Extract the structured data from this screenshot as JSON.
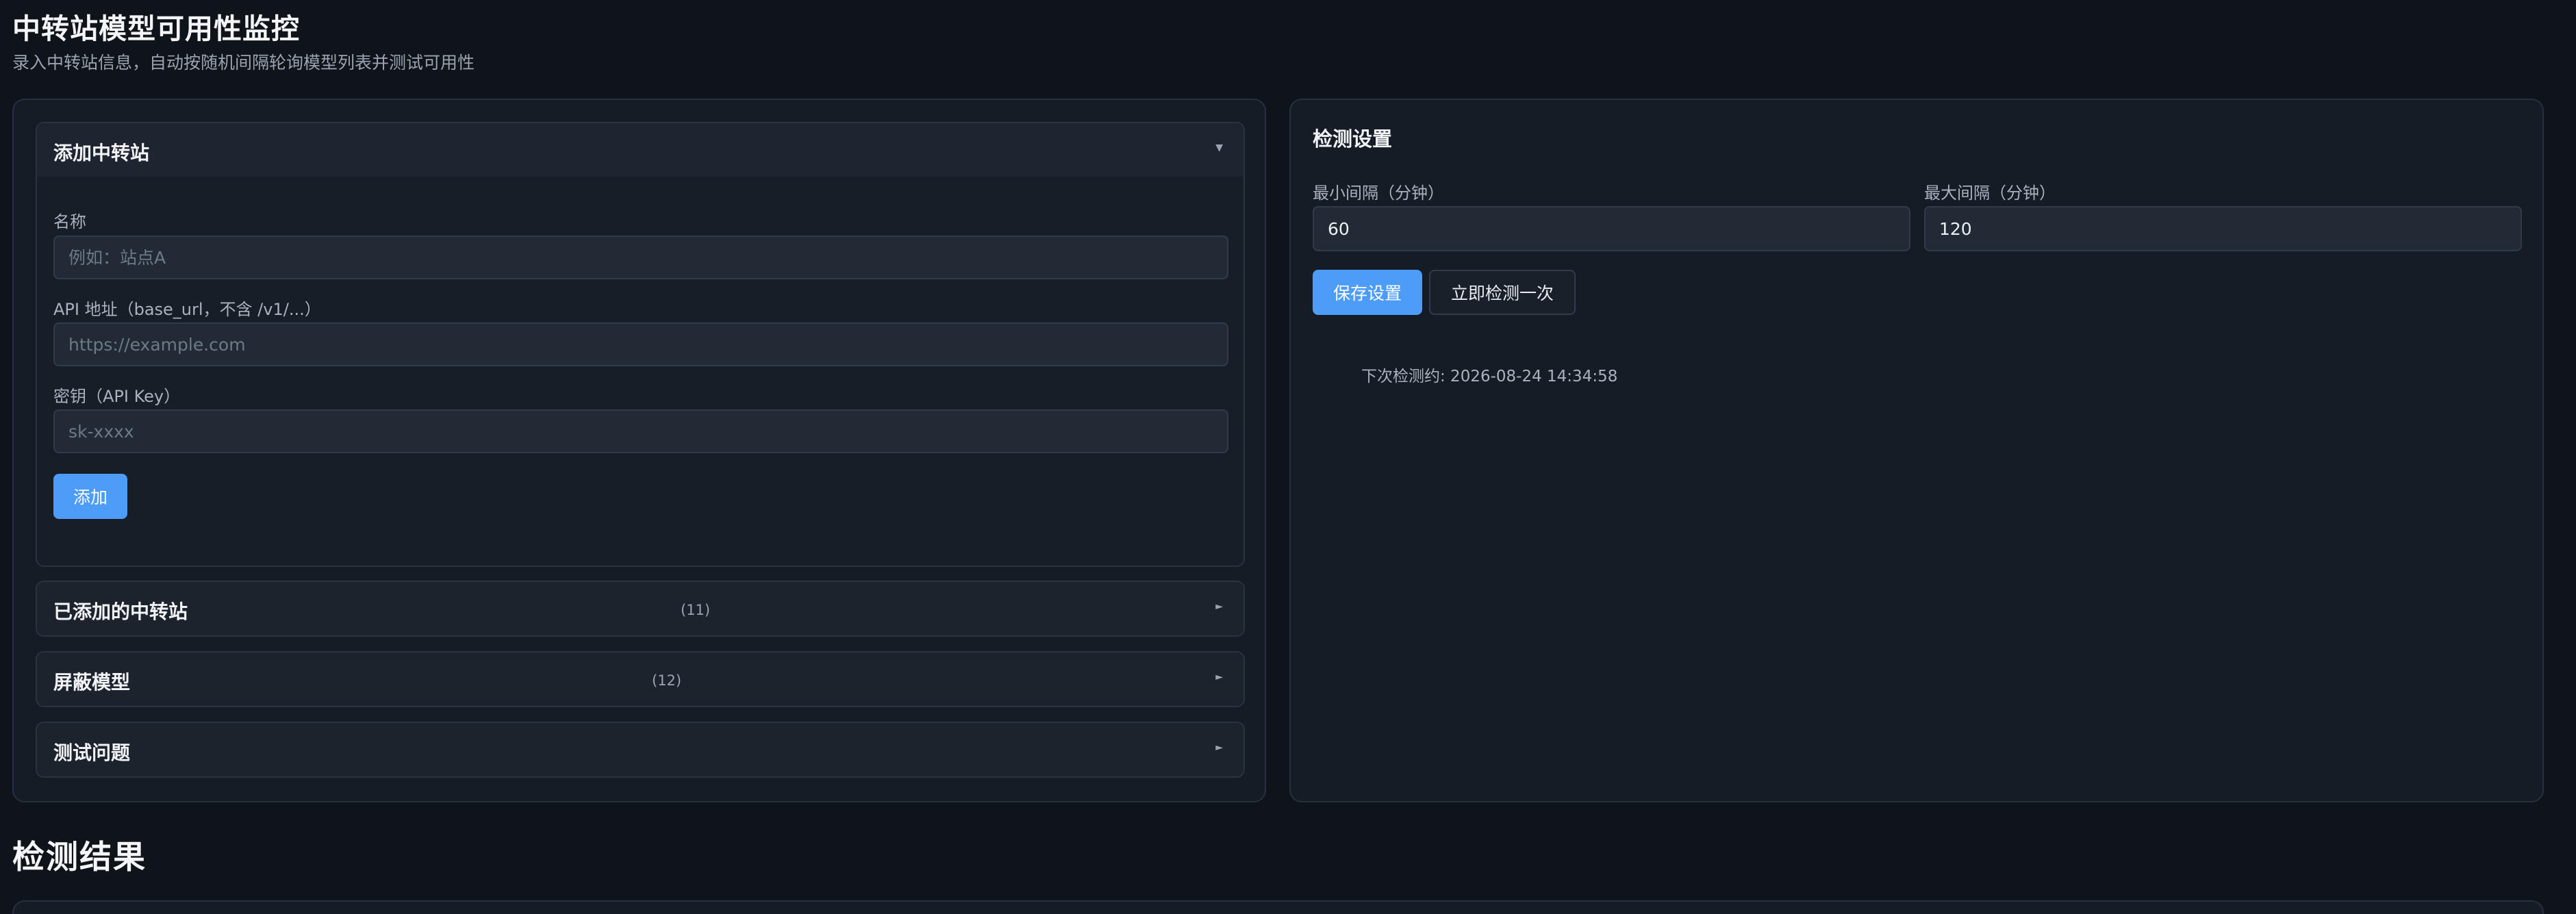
{
  "header": {
    "title": "中转站模型可用性监控",
    "subtitle": "录入中转站信息，自动按随机间隔轮询模型列表并测试可用性"
  },
  "add_station": {
    "title": "添加中转站",
    "name_label": "名称",
    "name_placeholder": "例如：站点A",
    "api_label": "API 地址（base_url，不含 /v1/...）",
    "api_placeholder": "https://example.com",
    "key_label": "密钥（API Key）",
    "key_placeholder": "sk-xxxx",
    "add_button": "添加",
    "caret": "▼"
  },
  "added_stations": {
    "title": "已添加的中转站",
    "count": "(11)",
    "caret": "►"
  },
  "blocked_models": {
    "title": "屏蔽模型",
    "count": "(12)",
    "caret": "►"
  },
  "test_questions": {
    "title": "测试问题",
    "caret": "►"
  },
  "settings": {
    "title": "检测设置",
    "min_interval_label": "最小间隔（分钟）",
    "min_interval_value": "60",
    "max_interval_label": "最大间隔（分钟）",
    "max_interval_value": "120",
    "save_button": "保存设置",
    "check_now_button": "立即检测一次",
    "next_check_text": "下次检测约: 2026-08-24 14:34:58"
  },
  "results": {
    "title": "检测结果"
  },
  "colors": {
    "background": "#0f141b",
    "panel": "#161c25",
    "accent": "#4d9cf8"
  }
}
